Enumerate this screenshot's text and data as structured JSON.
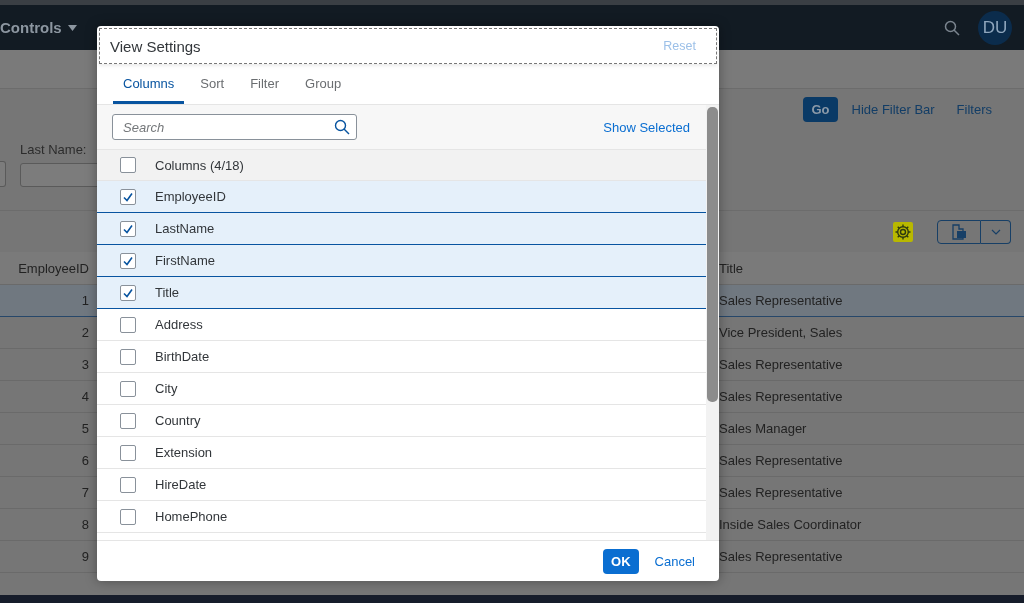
{
  "shell": {
    "title": "Controls",
    "avatar": "DU"
  },
  "filter_bar": {
    "fields": [
      {
        "label": "Last Name:"
      }
    ],
    "buttons": [
      {
        "label": "Go",
        "kind": "emphasized"
      },
      {
        "label": "Hide Filter Bar",
        "kind": "transparent"
      },
      {
        "label": "Filters",
        "kind": "transparent"
      }
    ]
  },
  "table": {
    "columns": [
      "EmployeeID",
      "Title"
    ],
    "rows": [
      {
        "cells": [
          "1",
          "Sales Representative"
        ],
        "selected": true
      },
      {
        "cells": [
          "2",
          "Vice President, Sales"
        ],
        "selected": false
      },
      {
        "cells": [
          "3",
          "Sales Representative"
        ],
        "selected": false
      },
      {
        "cells": [
          "4",
          "Sales Representative"
        ],
        "selected": false
      },
      {
        "cells": [
          "5",
          "Sales Manager"
        ],
        "selected": false
      },
      {
        "cells": [
          "6",
          "Sales Representative"
        ],
        "selected": false
      },
      {
        "cells": [
          "7",
          "Sales Representative"
        ],
        "selected": false
      },
      {
        "cells": [
          "8",
          "Inside Sales Coordinator"
        ],
        "selected": false
      },
      {
        "cells": [
          "9",
          "Sales Representative"
        ],
        "selected": false
      }
    ]
  },
  "dialog": {
    "title": "View Settings",
    "reset": {
      "label": "Reset",
      "disabled": true
    },
    "tabs": [
      {
        "label": "Columns",
        "selected": true
      },
      {
        "label": "Sort",
        "selected": false
      },
      {
        "label": "Filter",
        "selected": false
      },
      {
        "label": "Group",
        "selected": false
      }
    ],
    "search": {
      "placeholder": "Search"
    },
    "show_selected": "Show Selected",
    "select_all": {
      "label": "Columns (4/18)",
      "checked": false
    },
    "items": [
      {
        "label": "EmployeeID",
        "checked": true
      },
      {
        "label": "LastName",
        "checked": true
      },
      {
        "label": "FirstName",
        "checked": true
      },
      {
        "label": "Title",
        "checked": true
      },
      {
        "label": "Address",
        "checked": false
      },
      {
        "label": "BirthDate",
        "checked": false
      },
      {
        "label": "City",
        "checked": false
      },
      {
        "label": "Country",
        "checked": false
      },
      {
        "label": "Extension",
        "checked": false
      },
      {
        "label": "HireDate",
        "checked": false
      },
      {
        "label": "HomePhone",
        "checked": false
      }
    ],
    "buttons": [
      {
        "label": "OK",
        "kind": "emphasized"
      },
      {
        "label": "Cancel",
        "kind": "transparent"
      }
    ]
  }
}
